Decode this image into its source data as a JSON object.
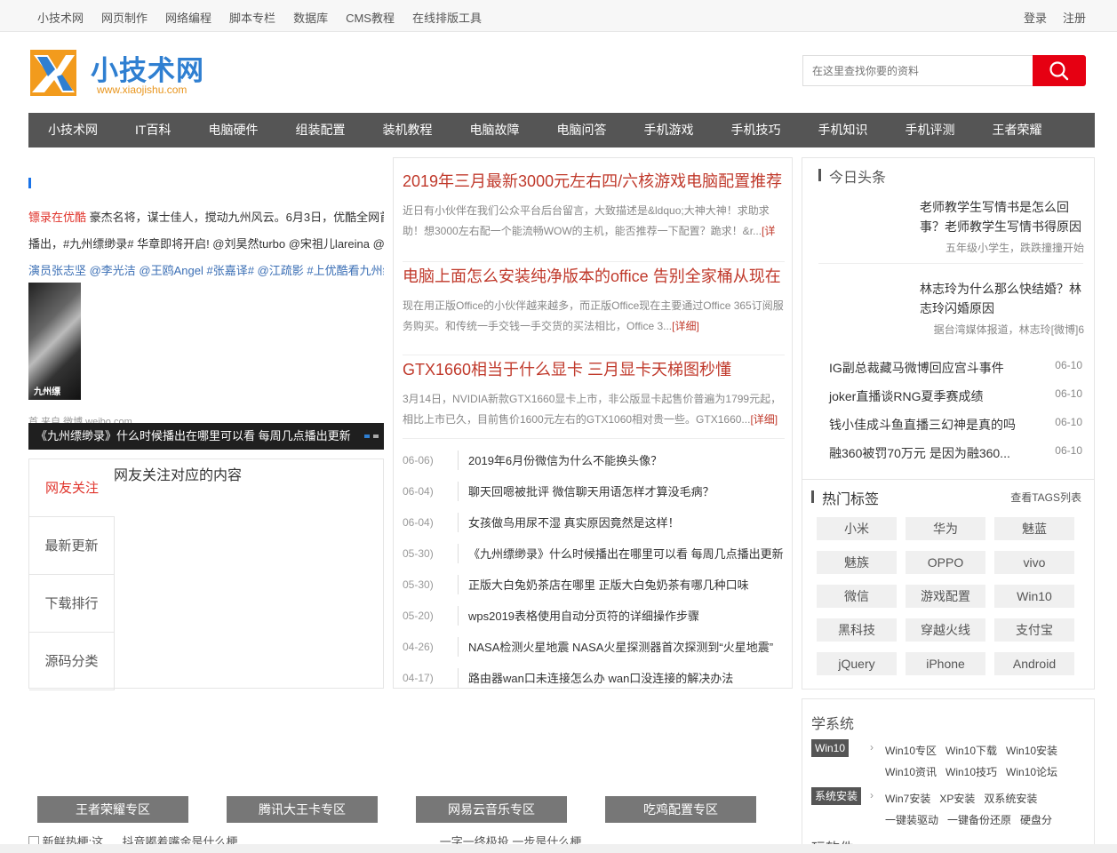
{
  "topbar": {
    "links": [
      "小技术网",
      "网页制作",
      "网络编程",
      "脚本专栏",
      "数据库",
      "CMS教程",
      "在线排版工具"
    ],
    "login": "登录",
    "register": "注册"
  },
  "logo": {
    "title": "小技术网",
    "url": "www.xiaojishu.com"
  },
  "search": {
    "placeholder": "在这里查找你要的资料"
  },
  "nav": [
    "小技术网",
    "IT百科",
    "电脑硬件",
    "组装配置",
    "装机教程",
    "电脑故障",
    "电脑问答",
    "手机游戏",
    "手机技巧",
    "手机知识",
    "手机评测",
    "王者荣耀"
  ],
  "slider": {
    "line1_red": "镖录在优酷",
    "line1_rest": " 豪杰名将，谋士佳人，搅动九州风云。6月3日，优酷全网首",
    "line2": "播出，#九州缥缈录# 华章即将开启! @刘昊然turbo @宋祖儿lareina @陈",
    "line3": "演员张志坚 @李光洁 @王鸥Angel #张嘉译# @江疏影 #上优酷看九州缥",
    "photo_caption": "九州缥",
    "source": "首 来自 微博 weibo.com",
    "caption": "《九州缥缈录》什么时候播出在哪里可以看 每周几点播出更新"
  },
  "tabbox": {
    "tabs": [
      "网友关注",
      "最新更新",
      "下载排行",
      "源码分类"
    ],
    "panel_title": "网友关注对应的内容"
  },
  "articles": [
    {
      "title": "2019年三月最新3000元左右四/六核游戏电脑配置推荐",
      "desc": "近日有小伙伴在我们公众平台后台留言，大致描述是&ldquo;大神大神！求助求助！想3000左右配一个能流畅WOW的主机，能否推荐一下配置？跪求！&r...",
      "more": "[详"
    },
    {
      "title": "电脑上面怎么安装纯净版本的office 告别全家桶从现在",
      "desc": "现在用正版Office的小伙伴越来越多，而正版Office现在主要通过Office 365订阅服务购买。和传统一手交钱一手交货的买法相比，Office 3...",
      "more": "[详细]"
    },
    {
      "title": "GTX1660相当于什么显卡 三月显卡天梯图秒懂",
      "desc": "3月14日，NVIDIA新款GTX1660显卡上市，非公版显卡起售价普遍为1799元起，相比上市已久，目前售价1600元左右的GTX1060相对贵一些。GTX1660...",
      "more": "[详细]"
    }
  ],
  "list": [
    {
      "date": "06-06)",
      "title": "2019年6月份微信为什么不能换头像？"
    },
    {
      "date": "06-04)",
      "title": "聊天回嗯被批评 微信聊天用语怎样才算没毛病？"
    },
    {
      "date": "06-04)",
      "title": "女孩做鸟用尿不湿 真实原因竟然是这样！"
    },
    {
      "date": "05-30)",
      "title": "《九州缥缈录》什么时候播出在哪里可以看 每周几点播出更新"
    },
    {
      "date": "05-30)",
      "title": "正版大白兔奶茶店在哪里 正版大白兔奶茶有哪几种口味"
    },
    {
      "date": "05-20)",
      "title": "wps2019表格使用自动分页符的详细操作步骤"
    },
    {
      "date": "04-26)",
      "title": "NASA检测火星地震 NASA火星探测器首次探测到“火星地震”"
    },
    {
      "date": "04-17)",
      "title": "路由器wan口未连接怎么办 wan口没连接的解决办法"
    }
  ],
  "today": {
    "title": "今日头条",
    "news": [
      {
        "title": "老师教学生写情书是怎么回事？老师教学生写情书得原因",
        "desc": "五年级小学生，跌跌撞撞开始"
      },
      {
        "title": "林志玲为什么那么快结婚？林志玲闪婚原因",
        "desc": "据台湾媒体报道，林志玲[微博]6"
      }
    ],
    "headlines": [
      {
        "title": "IG副总裁藏马微博回应宫斗事件",
        "date": "06-10"
      },
      {
        "title": "joker直播谈RNG夏季赛成绩",
        "date": "06-10"
      },
      {
        "title": "钱小佳成斗鱼直播三幻神是真的吗",
        "date": "06-10"
      },
      {
        "title": "融360被罚70万元 是因为融360...",
        "date": "06-10"
      }
    ]
  },
  "hot_tags": {
    "title": "热门标签",
    "more": "查看TAGS列表",
    "tags": [
      "小米",
      "华为",
      "魅蓝",
      "魅族",
      "OPPO",
      "vivo",
      "微信",
      "游戏配置",
      "Win10",
      "黑科技",
      "穿越火线",
      "支付宝",
      "jQuery",
      "iPhone",
      "Android"
    ]
  },
  "system": {
    "title": "学系统",
    "groups": [
      {
        "label": "Win10",
        "links": [
          "Win10专区",
          "Win10下载",
          "Win10安装",
          "Win10资讯",
          "Win10技巧",
          "Win10论坛"
        ]
      },
      {
        "label": "系统安装",
        "links": [
          "Win7安装",
          "XP安装",
          "双系统安装",
          "一键装驱动",
          "一键备份还原",
          "硬盘分"
        ]
      }
    ],
    "next_title": "玩软件"
  },
  "specials": [
    "王者荣耀专区",
    "腾讯大王卡专区",
    "网易云音乐专区",
    "吃鸡配置专区"
  ],
  "bottom": {
    "img_alt": "新鲜热梗:这",
    "text1": "抖音嘟着嘴金是什么梗",
    "text2": "一字一终极投 一步是什么梗"
  },
  "colors": {
    "accent": "#e60012",
    "nav_bg": "#555555",
    "title_red": "#c0392b",
    "logo_blue": "#2f7fd1"
  }
}
